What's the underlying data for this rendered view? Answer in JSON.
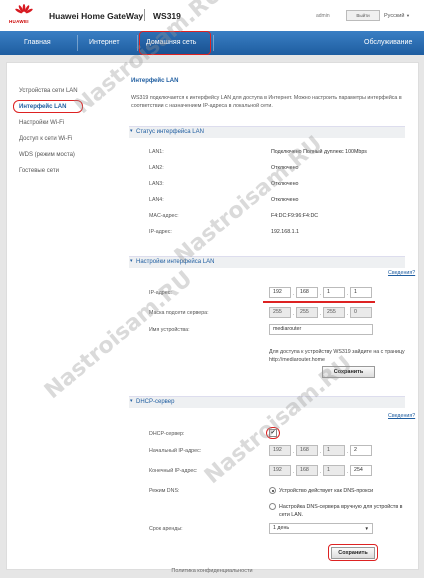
{
  "brand": {
    "logo_text": "HUAWEI",
    "title": "Huawei Home GateWay",
    "model": "WS319"
  },
  "header": {
    "user": "admin",
    "logout": "Выйти",
    "language": "Русский"
  },
  "nav": [
    "Главная",
    "Интернет",
    "Домашняя сеть",
    "Обслуживание"
  ],
  "sidebar": [
    "Устройства сети LAN",
    "Интерфейс LAN",
    "Настройки Wi-Fi",
    "Доступ к сети Wi-Fi",
    "WDS (режим моста)",
    "Гостевые сети"
  ],
  "page": {
    "title": "Интерфейс LAN",
    "description": "WS319 подключается к интерфейсу LAN для доступа в Интернет. Можно настроить параметры интерфейса в соответствии с назначением IP-адреса в локальной сети."
  },
  "status": {
    "section_title": "Статус интерфейса LAN",
    "rows": [
      {
        "label": "LAN1:",
        "value": "Подключено Полный дуплекс 100Mbps"
      },
      {
        "label": "LAN2:",
        "value": "Отключено"
      },
      {
        "label": "LAN3:",
        "value": "Отключено"
      },
      {
        "label": "LAN4:",
        "value": "Отключено"
      },
      {
        "label": "MAC-адрес:",
        "value": "F4:DC:F9:96:F4:DC"
      },
      {
        "label": "IP-адрес:",
        "value": "192.168.1.1"
      }
    ]
  },
  "lan_settings": {
    "section_title": "Настройки интерфейса LAN",
    "help": "Сведения?",
    "ip_label": "IP-адрес:",
    "ip": [
      "192",
      "168",
      "1",
      "1"
    ],
    "mask_label": "Маска подсети сервера:",
    "mask": [
      "255",
      "255",
      "255",
      "0"
    ],
    "device_label": "Имя устройства:",
    "device_name": "mediarouter",
    "hint": "Для доступа к устройству WS319 зайдите на с траницу http://mediarouter.home",
    "save": "Сохранить"
  },
  "dhcp": {
    "section_title": "DHCP-сервер",
    "help": "Сведения?",
    "enable_label": "DHCP-сервер:",
    "enabled_mark": "✔",
    "start_label": "Начальный IP-адрес:",
    "start_ip": [
      "192",
      "168",
      "1",
      "2"
    ],
    "end_label": "Конечный IP-адрес:",
    "end_ip": [
      "192",
      "168",
      "1",
      "254"
    ],
    "dns_label": "Режим DNS:",
    "dns_option_1": "Устройство действует как DNS-прокси",
    "dns_option_2": "Настройка DNS-сервера вручную для устройств в сети LAN.",
    "lease_label": "Срок аренды:",
    "lease_value": "1 день",
    "save": "Сохранить"
  },
  "footer": "Политика конфиденциальности",
  "watermark": "Nastroisam.RU",
  "colors": {
    "nav": "#1e5da0",
    "accent": "#1e5da0",
    "highlight": "#dd2222",
    "logo": "#cc0000"
  },
  "icons": [
    "huawei-logo",
    "caret-down-icon",
    "select-arrow-icon"
  ]
}
